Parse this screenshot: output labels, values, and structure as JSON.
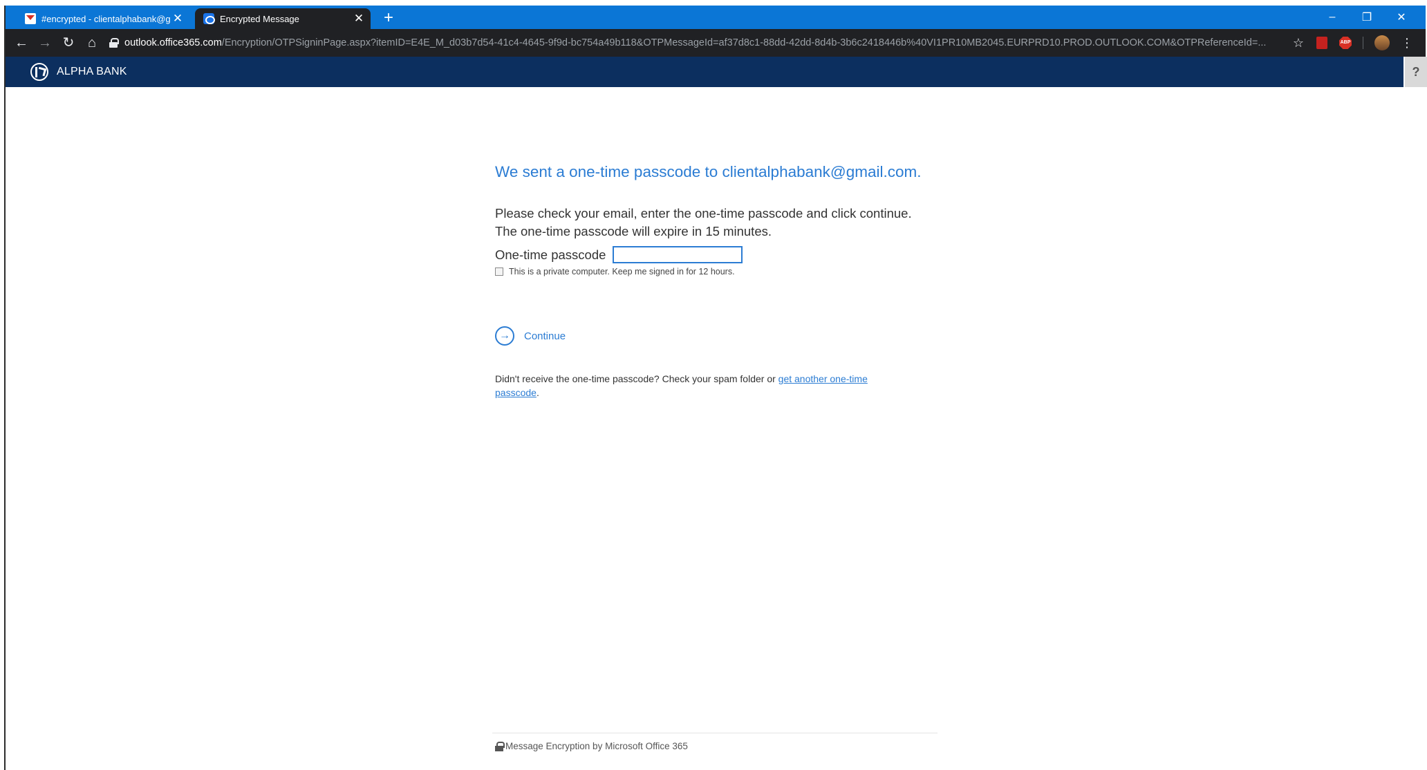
{
  "browser": {
    "tabs": [
      {
        "title": "#encrypted - clientalphabank@g",
        "icon": "gmail-icon",
        "active": false
      },
      {
        "title": "Encrypted Message",
        "icon": "outlook-icon",
        "active": true
      }
    ],
    "new_tab": "+",
    "url_host": "outlook.office365.com",
    "url_path": "/Encryption/OTPSigninPage.aspx?itemID=E4E_M_d03b7d54-41c4-4645-9f9d-bc754a49b118&OTPMessageId=af37d8c1-88dd-42dd-8d4b-3b6c2418446b%40VI1PR10MB2045.EURPRD10.PROD.OUTLOOK.COM&OTPReferenceId=...",
    "controls": {
      "minimize": "–",
      "restore": "❐",
      "close": "✕"
    },
    "colors": {
      "tab_strip": "#0b76d6",
      "toolbar": "#202124"
    }
  },
  "bank": {
    "name": "ALPHA BANK",
    "help": "?",
    "header_color": "#0c2f5f"
  },
  "otp": {
    "heading": "We sent a one-time passcode to clientalphabank@gmail.com.",
    "instruction_1": "Please check your email, enter the one-time passcode and click continue.",
    "instruction_2": "The one-time passcode will expire in 15 minutes.",
    "label": "One-time passcode",
    "value": "",
    "remember_label": "This is a private computer. Keep me signed in for 12 hours.",
    "continue_label": "Continue",
    "resend_prefix": "Didn't receive the one-time passcode? Check your spam folder or ",
    "resend_link": "get another one-time passcode",
    "resend_suffix": ".",
    "accent_color": "#2b7cd3"
  },
  "footer": {
    "text": "Message Encryption by Microsoft Office 365"
  }
}
